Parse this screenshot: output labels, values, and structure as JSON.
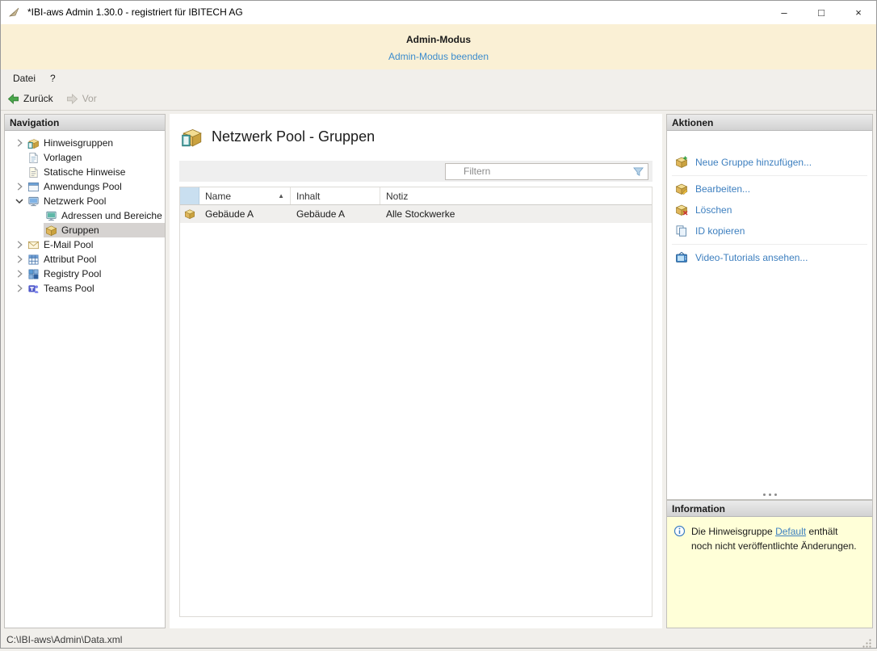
{
  "window": {
    "title": "*IBI-aws Admin 1.30.0 - registriert für IBITECH AG",
    "controls": {
      "minimize": "–",
      "maximize": "□",
      "close": "×"
    }
  },
  "banner": {
    "title": "Admin-Modus",
    "exit_link": "Admin-Modus beenden"
  },
  "menubar": {
    "items": [
      {
        "label": "Datei"
      },
      {
        "label": "?"
      }
    ]
  },
  "toolbar": {
    "back": "Zurück",
    "forward": "Vor"
  },
  "navigation": {
    "header": "Navigation",
    "items": [
      {
        "label": "Hinweisgruppen",
        "icon": "hint-groups-icon",
        "expander": "collapsed",
        "level": 0,
        "selected": false
      },
      {
        "label": "Vorlagen",
        "icon": "templates-icon",
        "expander": "none",
        "level": 0,
        "selected": false
      },
      {
        "label": "Statische Hinweise",
        "icon": "static-hints-icon",
        "expander": "none",
        "level": 0,
        "selected": false
      },
      {
        "label": "Anwendungs Pool",
        "icon": "application-pool-icon",
        "expander": "collapsed",
        "level": 0,
        "selected": false
      },
      {
        "label": "Netzwerk Pool",
        "icon": "network-pool-icon",
        "expander": "expanded",
        "level": 0,
        "selected": false
      },
      {
        "label": "Adressen und Bereiche",
        "icon": "addresses-ranges-icon",
        "expander": "none",
        "level": 1,
        "selected": false
      },
      {
        "label": "Gruppen",
        "icon": "groups-icon",
        "expander": "none",
        "level": 1,
        "selected": true
      },
      {
        "label": "E-Mail Pool",
        "icon": "email-pool-icon",
        "expander": "collapsed",
        "level": 0,
        "selected": false
      },
      {
        "label": "Attribut Pool",
        "icon": "attribute-pool-icon",
        "expander": "collapsed",
        "level": 0,
        "selected": false
      },
      {
        "label": "Registry Pool",
        "icon": "registry-pool-icon",
        "expander": "collapsed",
        "level": 0,
        "selected": false
      },
      {
        "label": "Teams Pool",
        "icon": "teams-pool-icon",
        "expander": "collapsed",
        "level": 0,
        "selected": false
      }
    ]
  },
  "main": {
    "title": "Netzwerk Pool - Gruppen",
    "filter": {
      "placeholder": "Filtern"
    },
    "table": {
      "columns": [
        "Name",
        "Inhalt",
        "Notiz"
      ],
      "sort": {
        "column": "Name",
        "direction": "ascending",
        "indicator": "▲"
      },
      "rows": [
        {
          "name": "Gebäude A",
          "inhalt": "Gebäude A",
          "notiz": "Alle Stockwerke"
        }
      ]
    }
  },
  "actions": {
    "header": "Aktionen",
    "items": [
      {
        "label": "Neue Gruppe hinzufügen...",
        "icon": "new-group-icon"
      },
      {
        "label": "Bearbeiten...",
        "icon": "edit-group-icon"
      },
      {
        "label": "Löschen",
        "icon": "delete-group-icon"
      },
      {
        "label": "ID kopieren",
        "icon": "copy-id-icon"
      },
      {
        "label": "Video-Tutorials ansehen...",
        "icon": "video-tutorials-icon"
      }
    ]
  },
  "information": {
    "header": "Information",
    "message_before": "Die Hinweisgruppe",
    "link": "Default",
    "message_after": "enthält noch nicht veröffentlichte Änderungen."
  },
  "statusbar": {
    "path": "C:\\IBI-aws\\Admin\\Data.xml"
  },
  "colors": {
    "banner_bg": "#faf0d5",
    "link_blue": "#3d7fbf",
    "info_bg": "#ffffd8",
    "selected_item_bg": "#d6d3d1",
    "back_arrow_green": "#4aa64a",
    "filter_header_cell_blue": "#c9dff0"
  }
}
